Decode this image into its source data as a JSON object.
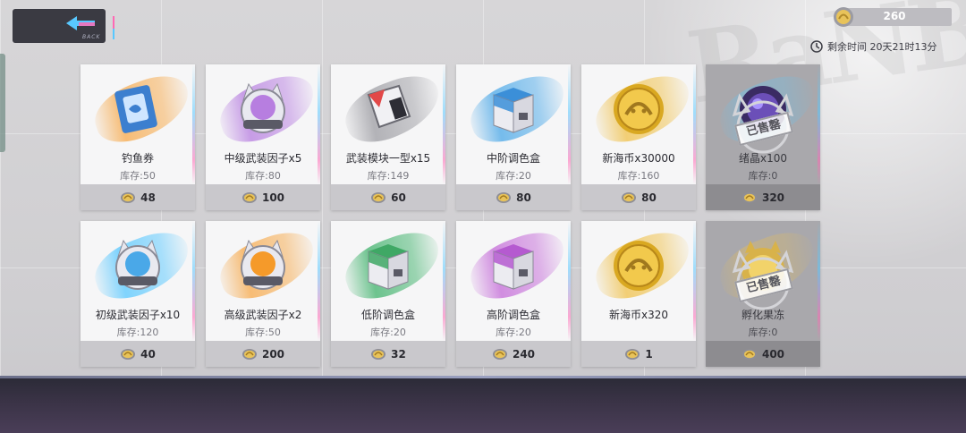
{
  "header": {
    "back_label": "BACK",
    "currency_value": "260",
    "timer_label": "剩余时间 20天21时13分"
  },
  "colors": {
    "orange": "#f7a94a",
    "purple": "#b77ee0",
    "gray": "#9c9ca2",
    "blue": "#4aa8e8",
    "gold": "#f0c14a",
    "teal": "#58c8ff",
    "green": "#3fb26b",
    "magenta": "#c46ad8"
  },
  "items": [
    {
      "name": "钓鱼券",
      "stock": "库存:50",
      "price": "48",
      "icon": "fishing-ticket-icon",
      "sold": false
    },
    {
      "name": "中级武装因子x5",
      "stock": "库存:80",
      "price": "100",
      "icon": "cat-helmet-purple-icon",
      "sold": false
    },
    {
      "name": "武装模块一型x15",
      "stock": "库存:149",
      "price": "60",
      "icon": "weapon-module-icon",
      "sold": false
    },
    {
      "name": "中阶调色盒",
      "stock": "库存:20",
      "price": "80",
      "icon": "dye-box-blue-icon",
      "sold": false
    },
    {
      "name": "新海币x30000",
      "stock": "库存:160",
      "price": "80",
      "icon": "gold-coin-icon",
      "sold": false
    },
    {
      "name": "绪晶x100",
      "stock": "库存:0",
      "price": "320",
      "icon": "crystal-icon",
      "sold": true,
      "sold_label": "已售罄"
    },
    {
      "name": "初级武装因子x10",
      "stock": "库存:120",
      "price": "40",
      "icon": "cat-helmet-blue-icon",
      "sold": false
    },
    {
      "name": "高级武装因子x2",
      "stock": "库存:50",
      "price": "200",
      "icon": "cat-helmet-orange-icon",
      "sold": false
    },
    {
      "name": "低阶调色盒",
      "stock": "库存:20",
      "price": "32",
      "icon": "dye-box-green-icon",
      "sold": false
    },
    {
      "name": "高阶调色盒",
      "stock": "库存:20",
      "price": "240",
      "icon": "dye-box-purple-icon",
      "sold": false
    },
    {
      "name": "新海币x320",
      "stock": "",
      "price": "1",
      "icon": "gold-coin-icon",
      "sold": false
    },
    {
      "name": "孵化果冻",
      "stock": "库存:0",
      "price": "400",
      "icon": "jelly-icon",
      "sold": true,
      "sold_label": "已售罄"
    }
  ]
}
